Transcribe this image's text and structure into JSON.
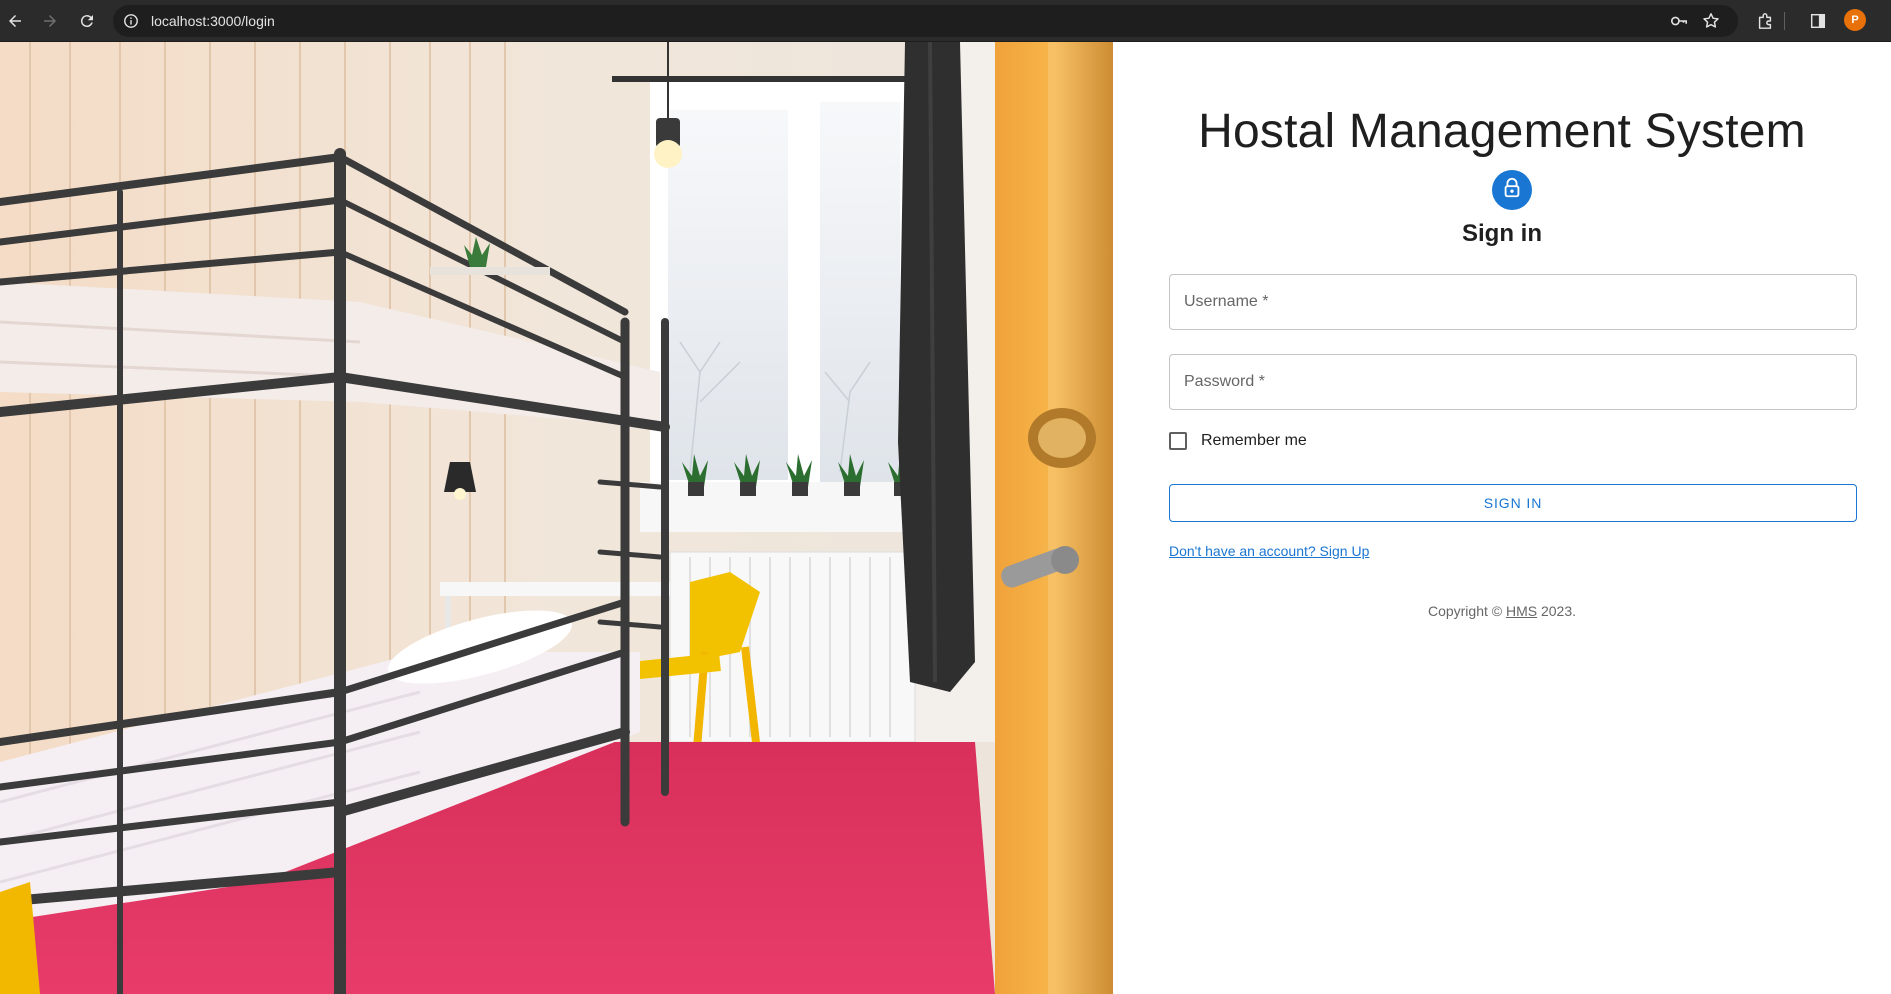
{
  "browser": {
    "url": "localhost:3000/login",
    "profile_initial": "P",
    "profile_color": "#e8710a"
  },
  "hero_image": {
    "subject": "hostel room with bunk bed"
  },
  "form": {
    "app_title": "Hostal Management System",
    "avatar_icon": "lock-icon",
    "heading": "Sign in",
    "username_label": "Username *",
    "password_label": "Password *",
    "remember_label": "Remember me",
    "remember_checked": false,
    "submit_label": "SIGN IN",
    "signup_link": "Don't have an account? Sign Up",
    "copyright_prefix": "Copyright ©",
    "copyright_brand": "HMS",
    "copyright_year": "2023."
  },
  "colors": {
    "primary": "#1976d2",
    "field_border": "#c4c4c4",
    "label_gray": "#666666"
  }
}
